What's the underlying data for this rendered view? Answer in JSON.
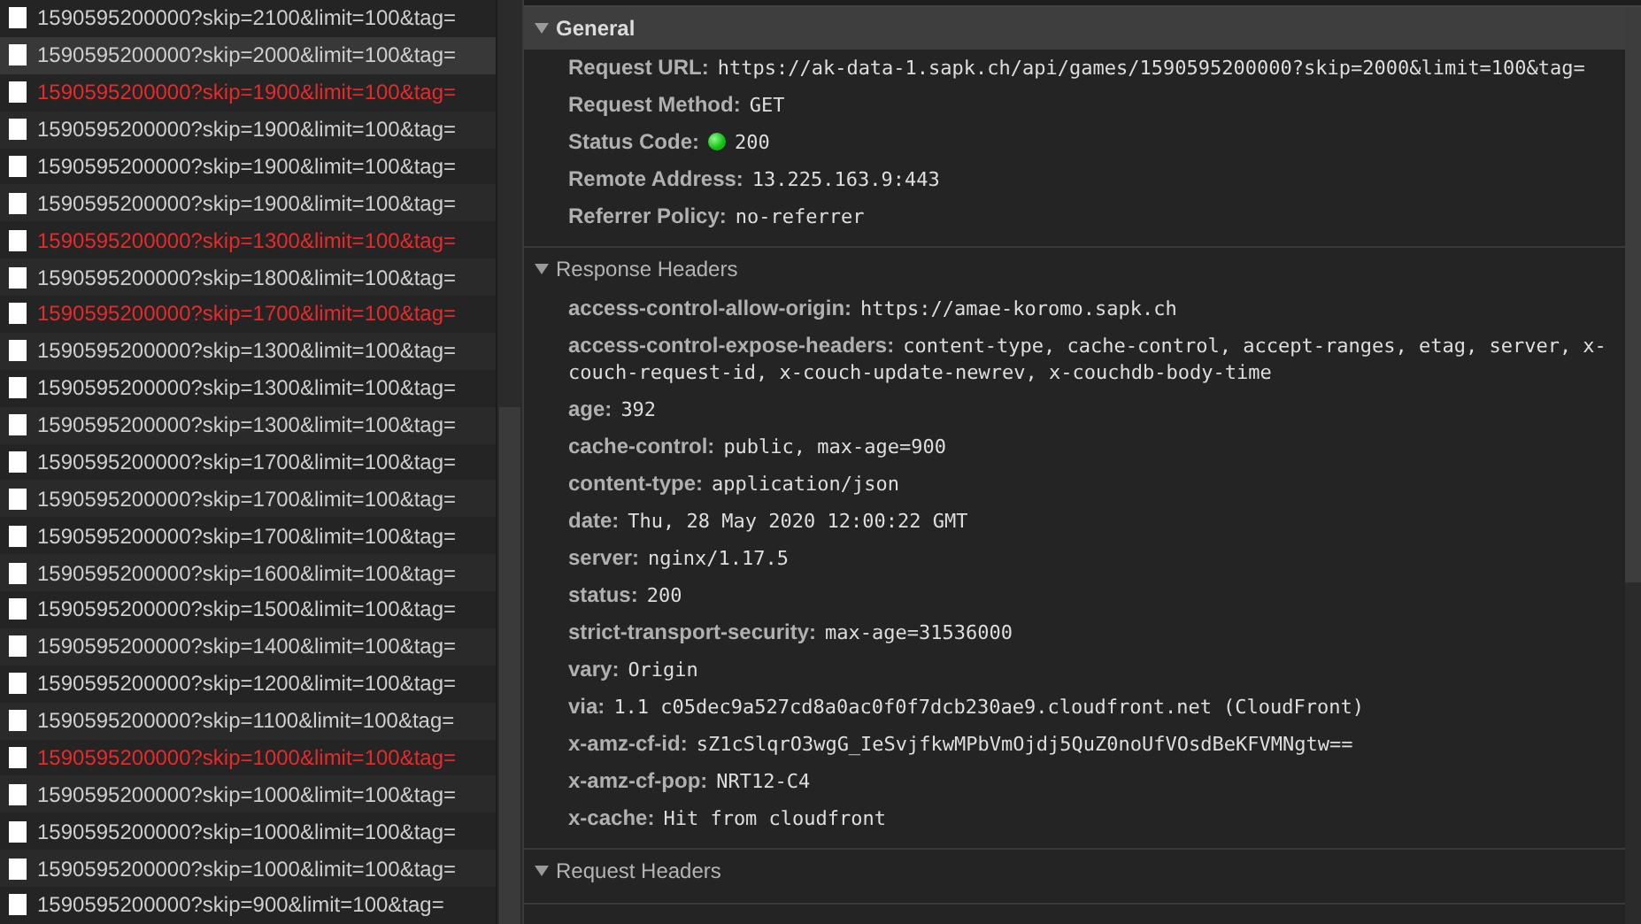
{
  "requests": [
    {
      "name": "1590595200000?skip=2100&limit=100&tag=",
      "failed": false,
      "selected": false
    },
    {
      "name": "1590595200000?skip=2000&limit=100&tag=",
      "failed": false,
      "selected": true
    },
    {
      "name": "1590595200000?skip=1900&limit=100&tag=",
      "failed": true,
      "selected": false
    },
    {
      "name": "1590595200000?skip=1900&limit=100&tag=",
      "failed": false,
      "selected": false
    },
    {
      "name": "1590595200000?skip=1900&limit=100&tag=",
      "failed": false,
      "selected": false
    },
    {
      "name": "1590595200000?skip=1900&limit=100&tag=",
      "failed": false,
      "selected": false
    },
    {
      "name": "1590595200000?skip=1300&limit=100&tag=",
      "failed": true,
      "selected": false
    },
    {
      "name": "1590595200000?skip=1800&limit=100&tag=",
      "failed": false,
      "selected": false
    },
    {
      "name": "1590595200000?skip=1700&limit=100&tag=",
      "failed": true,
      "selected": false
    },
    {
      "name": "1590595200000?skip=1300&limit=100&tag=",
      "failed": false,
      "selected": false
    },
    {
      "name": "1590595200000?skip=1300&limit=100&tag=",
      "failed": false,
      "selected": false
    },
    {
      "name": "1590595200000?skip=1300&limit=100&tag=",
      "failed": false,
      "selected": false
    },
    {
      "name": "1590595200000?skip=1700&limit=100&tag=",
      "failed": false,
      "selected": false
    },
    {
      "name": "1590595200000?skip=1700&limit=100&tag=",
      "failed": false,
      "selected": false
    },
    {
      "name": "1590595200000?skip=1700&limit=100&tag=",
      "failed": false,
      "selected": false
    },
    {
      "name": "1590595200000?skip=1600&limit=100&tag=",
      "failed": false,
      "selected": false
    },
    {
      "name": "1590595200000?skip=1500&limit=100&tag=",
      "failed": false,
      "selected": false
    },
    {
      "name": "1590595200000?skip=1400&limit=100&tag=",
      "failed": false,
      "selected": false
    },
    {
      "name": "1590595200000?skip=1200&limit=100&tag=",
      "failed": false,
      "selected": false
    },
    {
      "name": "1590595200000?skip=1100&limit=100&tag=",
      "failed": false,
      "selected": false
    },
    {
      "name": "1590595200000?skip=1000&limit=100&tag=",
      "failed": true,
      "selected": false
    },
    {
      "name": "1590595200000?skip=1000&limit=100&tag=",
      "failed": false,
      "selected": false
    },
    {
      "name": "1590595200000?skip=1000&limit=100&tag=",
      "failed": false,
      "selected": false
    },
    {
      "name": "1590595200000?skip=1000&limit=100&tag=",
      "failed": false,
      "selected": false
    },
    {
      "name": "1590595200000?skip=900&limit=100&tag=",
      "failed": false,
      "selected": false
    }
  ],
  "detail": {
    "sections": [
      {
        "title": "General",
        "expanded": true,
        "selected": true,
        "items": [
          {
            "kind": "plain",
            "key": "Request URL:",
            "value": "https://ak-data-1.sapk.ch/api/games/1590595200000?skip=2000&limit=100&tag="
          },
          {
            "kind": "plain",
            "key": "Request Method:",
            "value": "GET"
          },
          {
            "kind": "status",
            "key": "Status Code:",
            "value": "200"
          },
          {
            "kind": "plain",
            "key": "Remote Address:",
            "value": "13.225.163.9:443"
          },
          {
            "kind": "plain",
            "key": "Referrer Policy:",
            "value": "no-referrer"
          }
        ]
      },
      {
        "title": "Response Headers",
        "expanded": true,
        "selected": false,
        "items": [
          {
            "kind": "plain",
            "key": "access-control-allow-origin:",
            "value": "https://amae-koromo.sapk.ch"
          },
          {
            "kind": "plain",
            "key": "access-control-expose-headers:",
            "value": "content-type, cache-control, accept-ranges, etag, server, x-couch-request-id, x-couch-update-newrev, x-couchdb-body-time"
          },
          {
            "kind": "plain",
            "key": "age:",
            "value": "392"
          },
          {
            "kind": "plain",
            "key": "cache-control:",
            "value": "public, max-age=900"
          },
          {
            "kind": "plain",
            "key": "content-type:",
            "value": "application/json"
          },
          {
            "kind": "plain",
            "key": "date:",
            "value": "Thu, 28 May 2020 12:00:22 GMT"
          },
          {
            "kind": "plain",
            "key": "server:",
            "value": "nginx/1.17.5"
          },
          {
            "kind": "plain",
            "key": "status:",
            "value": "200"
          },
          {
            "kind": "plain",
            "key": "strict-transport-security:",
            "value": "max-age=31536000"
          },
          {
            "kind": "plain",
            "key": "vary:",
            "value": "Origin"
          },
          {
            "kind": "plain",
            "key": "via:",
            "value": "1.1 c05dec9a527cd8a0ac0f0f7dcb230ae9.cloudfront.net (CloudFront)"
          },
          {
            "kind": "plain",
            "key": "x-amz-cf-id:",
            "value": "sZ1cSlqrO3wgG_IeSvjfkwMPbVmOjdj5QuZ0noUfVOsdBeKFVMNgtw=="
          },
          {
            "kind": "plain",
            "key": "x-amz-cf-pop:",
            "value": "NRT12-C4"
          },
          {
            "kind": "plain",
            "key": "x-cache:",
            "value": "Hit from cloudfront"
          }
        ]
      },
      {
        "title": "Request Headers",
        "expanded": true,
        "selected": false
      }
    ]
  }
}
